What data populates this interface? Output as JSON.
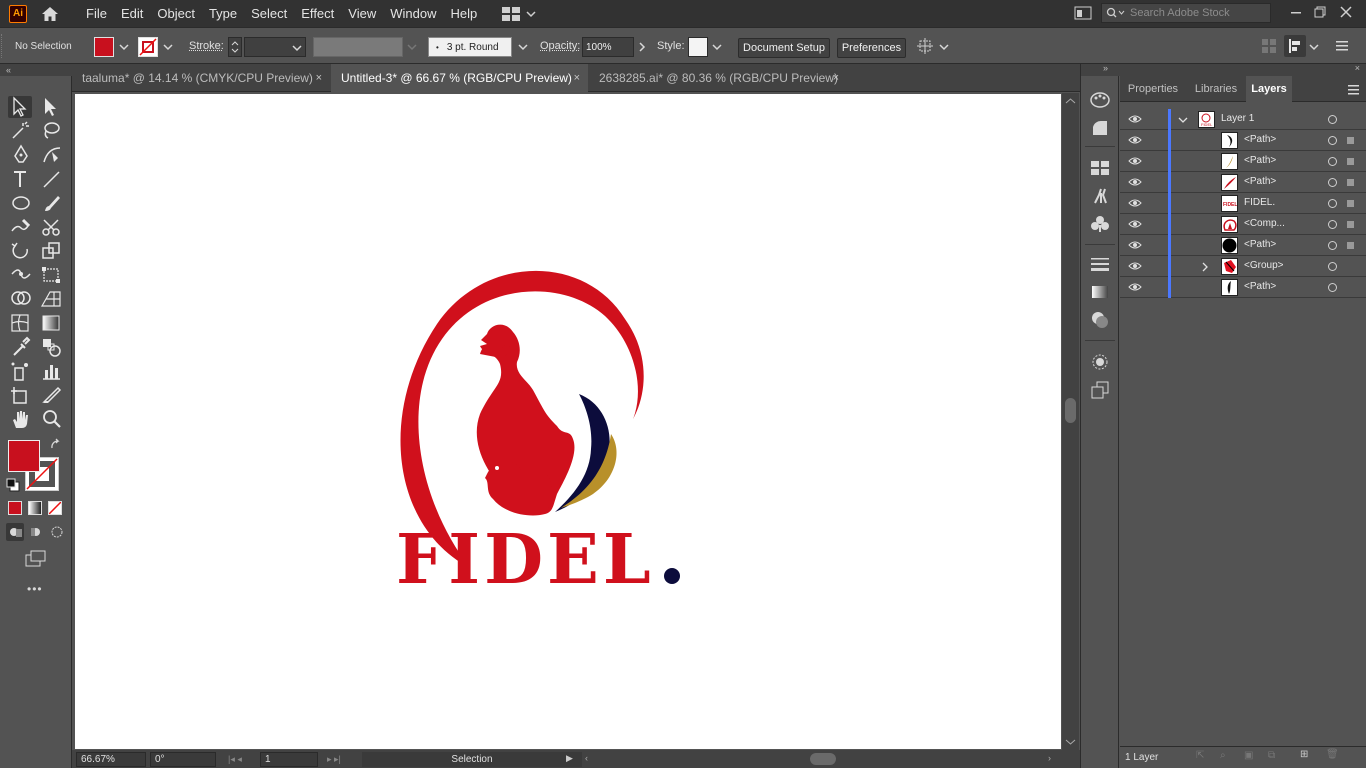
{
  "menubar": {
    "logo": "Ai",
    "items": [
      "File",
      "Edit",
      "Object",
      "Type",
      "Select",
      "Effect",
      "View",
      "Window",
      "Help"
    ],
    "search_placeholder": "Search Adobe Stock",
    "icons": [
      "home-icon",
      "workspace-switcher-icon",
      "panel-toggle-icon",
      "search-icon",
      "minimize-icon",
      "restore-icon",
      "close-icon"
    ]
  },
  "control": {
    "selection": "No Selection",
    "fill_color": "#c8101e",
    "stroke_label": "Stroke:",
    "brush": "3 pt. Round",
    "opacity_label": "Opacity:",
    "opacity": "100%",
    "style_label": "Style:",
    "document_setup": "Document Setup",
    "preferences": "Preferences"
  },
  "tabs": [
    {
      "label": "taaluma* @ 14.14 % (CMYK/CPU Preview)",
      "close": "×"
    },
    {
      "label": "Untitled-3* @ 66.67 % (RGB/CPU Preview)",
      "close": "×"
    },
    {
      "label": "2638285.ai* @ 80.36 % (RGB/CPU Preview)",
      "close": "×"
    }
  ],
  "tools": {
    "list": [
      "selection-tool",
      "direct-selection-tool",
      "magic-wand-tool",
      "lasso-tool",
      "pen-tool",
      "curvature-tool",
      "type-tool",
      "line-tool",
      "ellipse-tool",
      "paintbrush-tool",
      "shaper-tool",
      "scissors-tool",
      "rotate-tool",
      "scale-tool",
      "width-tool",
      "free-transform-tool",
      "shape-builder-tool",
      "perspective-grid-tool",
      "mesh-tool",
      "gradient-tool",
      "eyedropper-tool",
      "blend-tool",
      "symbol-sprayer-tool",
      "column-graph-tool",
      "artboard-tool",
      "slice-tool",
      "hand-tool",
      "zoom-tool"
    ],
    "fill": "#c8101e",
    "more": "•••"
  },
  "artwork": {
    "wordmark": "FIDEL",
    "dot": ".",
    "red": "#d0101c",
    "navy": "#0c0c3c",
    "gold": "#b8902a"
  },
  "status": {
    "zoom": "66.67%",
    "rotate": "0°",
    "artboard": "1",
    "tool": "Selection"
  },
  "panel": {
    "tabs": [
      "Properties",
      "Libraries",
      "Layers"
    ],
    "active_tab": "Layers",
    "layers": [
      {
        "name": "Layer 1",
        "kind": "layer"
      },
      {
        "name": "<Path>",
        "kind": "item"
      },
      {
        "name": "<Path>",
        "kind": "item"
      },
      {
        "name": "<Path>",
        "kind": "item"
      },
      {
        "name": "FIDEL.",
        "kind": "item"
      },
      {
        "name": "<Comp...",
        "kind": "item"
      },
      {
        "name": "<Path>",
        "kind": "item"
      },
      {
        "name": "<Group>",
        "kind": "group"
      },
      {
        "name": "<Path>",
        "kind": "item"
      }
    ],
    "footer": "1 Layer"
  }
}
